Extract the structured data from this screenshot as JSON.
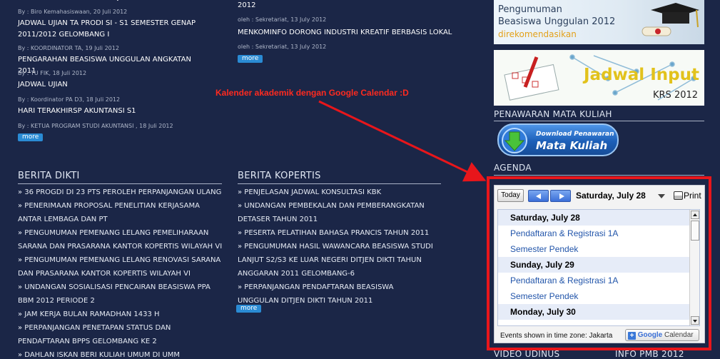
{
  "left_news": [
    {
      "meta": "By : Biro Kemahasiswaan, 20 Juli 2012",
      "title": "JADWAL UJIAN TA PRODI SI - S1 SEMESTER GENAP 2011/2012 GELOMBANG I"
    },
    {
      "meta": "By : KOORDINATOR TA, 19 Juli 2012",
      "title": "PENGARAHAN BEASISWA UNGGULAN ANGKATAN 2011"
    },
    {
      "meta": "By : TU FIK, 18 Juli 2012",
      "title": "JADWAL UJIAN"
    },
    {
      "meta": "By : Koordinator PA D3, 18 Juli 2012",
      "title": "HARI TERAKHIRSP AKUNTANSI S1"
    },
    {
      "meta": "By : KETUA PROGRAM STUDI AKUNTANSI , 18 Juli 2012",
      "title": ""
    }
  ],
  "mid_news": [
    {
      "title": "2012"
    },
    {
      "meta": "oleh : Sekretariat, 13 July 2012",
      "title": "MENKOMINFO DORONG INDUSTRI KREATIF BERBASIS LOKAL"
    },
    {
      "meta": "oleh : Sekretariat, 13 July 2012"
    }
  ],
  "more_label": "more",
  "annotation": "Kalender akademik dengan Google Calendar :D",
  "berita_dikti": {
    "title": "BERITA DIKTI",
    "items": [
      "36 PROGDI DI 23 PTS PEROLEH PERPANJANGAN ULANG",
      "PENERIMAAN PROPOSAL PENELITIAN KERJASAMA ANTAR LEMBAGA DAN PT",
      "PENGUMUMAN PEMENANG LELANG PEMELIHARAAN SARANA DAN PRASARANA KANTOR KOPERTIS WILAYAH VI",
      "PENGUMUMAN PEMENANG LELANG RENOVASI SARANA DAN PRASARANA KANTOR KOPERTIS WILAYAH VI",
      "UNDANGAN SOSIALISASI PENCAIRAN BEASISWA PPA BBM 2012 PERIODE 2",
      "JAM KERJA BULAN RAMADHAN 1433 H",
      "PERPANJANGAN PENETAPAN STATUS DAN PENDAFTARAN BPPS GELOMBANG KE 2",
      "DAHLAN ISKAN BERI KULIAH UMUM DI UMM"
    ]
  },
  "berita_kopertis": {
    "title": "BERITA KOPERTIS",
    "items": [
      "PENJELASAN JADWAL KONSULTASI KBK",
      "UNDANGAN PEMBEKALAN DAN PEMBERANGKATAN DETASER TAHUN 2011",
      "PESERTA PELATIHAN BAHASA PRANCIS TAHUN 2011",
      "PENGUMUMAN HASIL WAWANCARA BEASISWA STUDI LANJUT S2/S3 KE LUAR NEGERI DITJEN DIKTI TAHUN ANGGARAN 2011 GELOMBANG-6",
      "PERPANJANGAN PENDAFTARAN BEASISWA UNGGULAN DITJEN DIKTI TAHUN 2011"
    ]
  },
  "sidebar": {
    "banner1": {
      "line1": "Pengumuman",
      "line2": "Beasiswa Unggulan 2012",
      "line3": "direkomendasikan"
    },
    "banner2": {
      "line1": "Jadwal Input",
      "line2": "KRS 2012"
    },
    "penawaran_title": "PENAWARAN MATA KULIAH",
    "download": {
      "line1": "Download Penawaran",
      "line2": "Mata Kuliah"
    },
    "agenda_title": "AGENDA",
    "bottom_left": "VIDEO UDINUS",
    "bottom_right": "INFO PMB 2012"
  },
  "calendar": {
    "today_label": "Today",
    "current_date": "Saturday, July 28",
    "print_label": "Print",
    "rows": [
      {
        "type": "day",
        "text": "Saturday, July 28"
      },
      {
        "type": "event",
        "text": "Pendaftaran & Registrasi 1A"
      },
      {
        "type": "event",
        "text": "Semester Pendek"
      },
      {
        "type": "day",
        "text": "Sunday, July 29"
      },
      {
        "type": "event",
        "text": "Pendaftaran & Registrasi 1A"
      },
      {
        "type": "event",
        "text": "Semester Pendek"
      },
      {
        "type": "day",
        "text": "Monday, July 30"
      }
    ],
    "timezone_text": "Events shown in time zone: Jakarta",
    "gcal_google": "Google",
    "gcal_calendar": "Calendar"
  },
  "colors": {
    "background": "#1b2647",
    "annotation": "#ff2a1f",
    "more_button": "#2a8bd4"
  }
}
